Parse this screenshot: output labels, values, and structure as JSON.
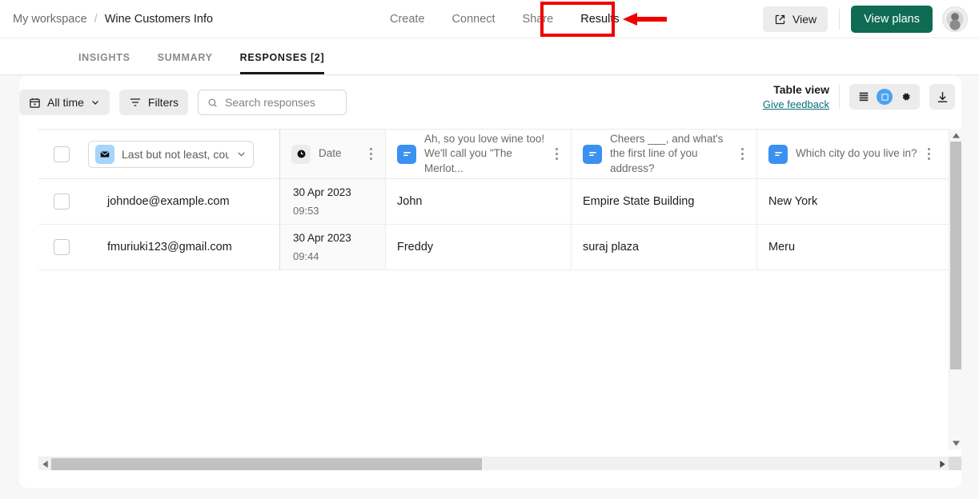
{
  "breadcrumb": {
    "workspace": "My workspace",
    "separator": "/",
    "form_name": "Wine Customers Info"
  },
  "nav_tabs": [
    {
      "label": "Create",
      "active": false
    },
    {
      "label": "Connect",
      "active": false
    },
    {
      "label": "Share",
      "active": false
    },
    {
      "label": "Results",
      "active": true
    }
  ],
  "top_right": {
    "view_label": "View",
    "view_plans_label": "View plans"
  },
  "subtabs": [
    {
      "label": "INSIGHTS",
      "active": false
    },
    {
      "label": "SUMMARY",
      "active": false
    },
    {
      "label": "RESPONSES [2]",
      "active": true
    }
  ],
  "toolbar": {
    "all_time_label": "All time",
    "filters_label": "Filters",
    "search_placeholder": "Search responses",
    "search_value": "",
    "table_view_label": "Table view",
    "give_feedback_label": "Give feedback"
  },
  "columns": [
    {
      "key": "email",
      "title": "Last but not least, cou",
      "icon": "envelope-icon"
    },
    {
      "key": "date",
      "title": "Date",
      "icon": "clock-icon"
    },
    {
      "key": "q1",
      "title": "Ah, so you love wine too! We'll call you \"The Merlot...",
      "icon": "short-text-icon"
    },
    {
      "key": "q2",
      "title": "Cheers ___, and what's the first line of you address?",
      "icon": "short-text-icon"
    },
    {
      "key": "q3",
      "title": "Which city do you live in?",
      "icon": "short-text-icon"
    }
  ],
  "rows": [
    {
      "email": "johndoe@example.com",
      "date": "30 Apr 2023",
      "time": "09:53",
      "q1": "John",
      "q2": "Empire State Building",
      "q3": "New York"
    },
    {
      "email": "fmuriuki123@gmail.com",
      "date": "30 Apr 2023",
      "time": "09:44",
      "q1": "Freddy",
      "q2": "suraj plaza",
      "q3": "Meru"
    }
  ],
  "colors": {
    "accent_green": "#0f6b54",
    "annotation_red": "#ee0000",
    "active_toggle_blue": "#4aa3f0",
    "link_teal": "#0a6e80",
    "short_text_icon_blue": "#3b91f0",
    "envelope_icon_blue": "#a6d4fb"
  }
}
